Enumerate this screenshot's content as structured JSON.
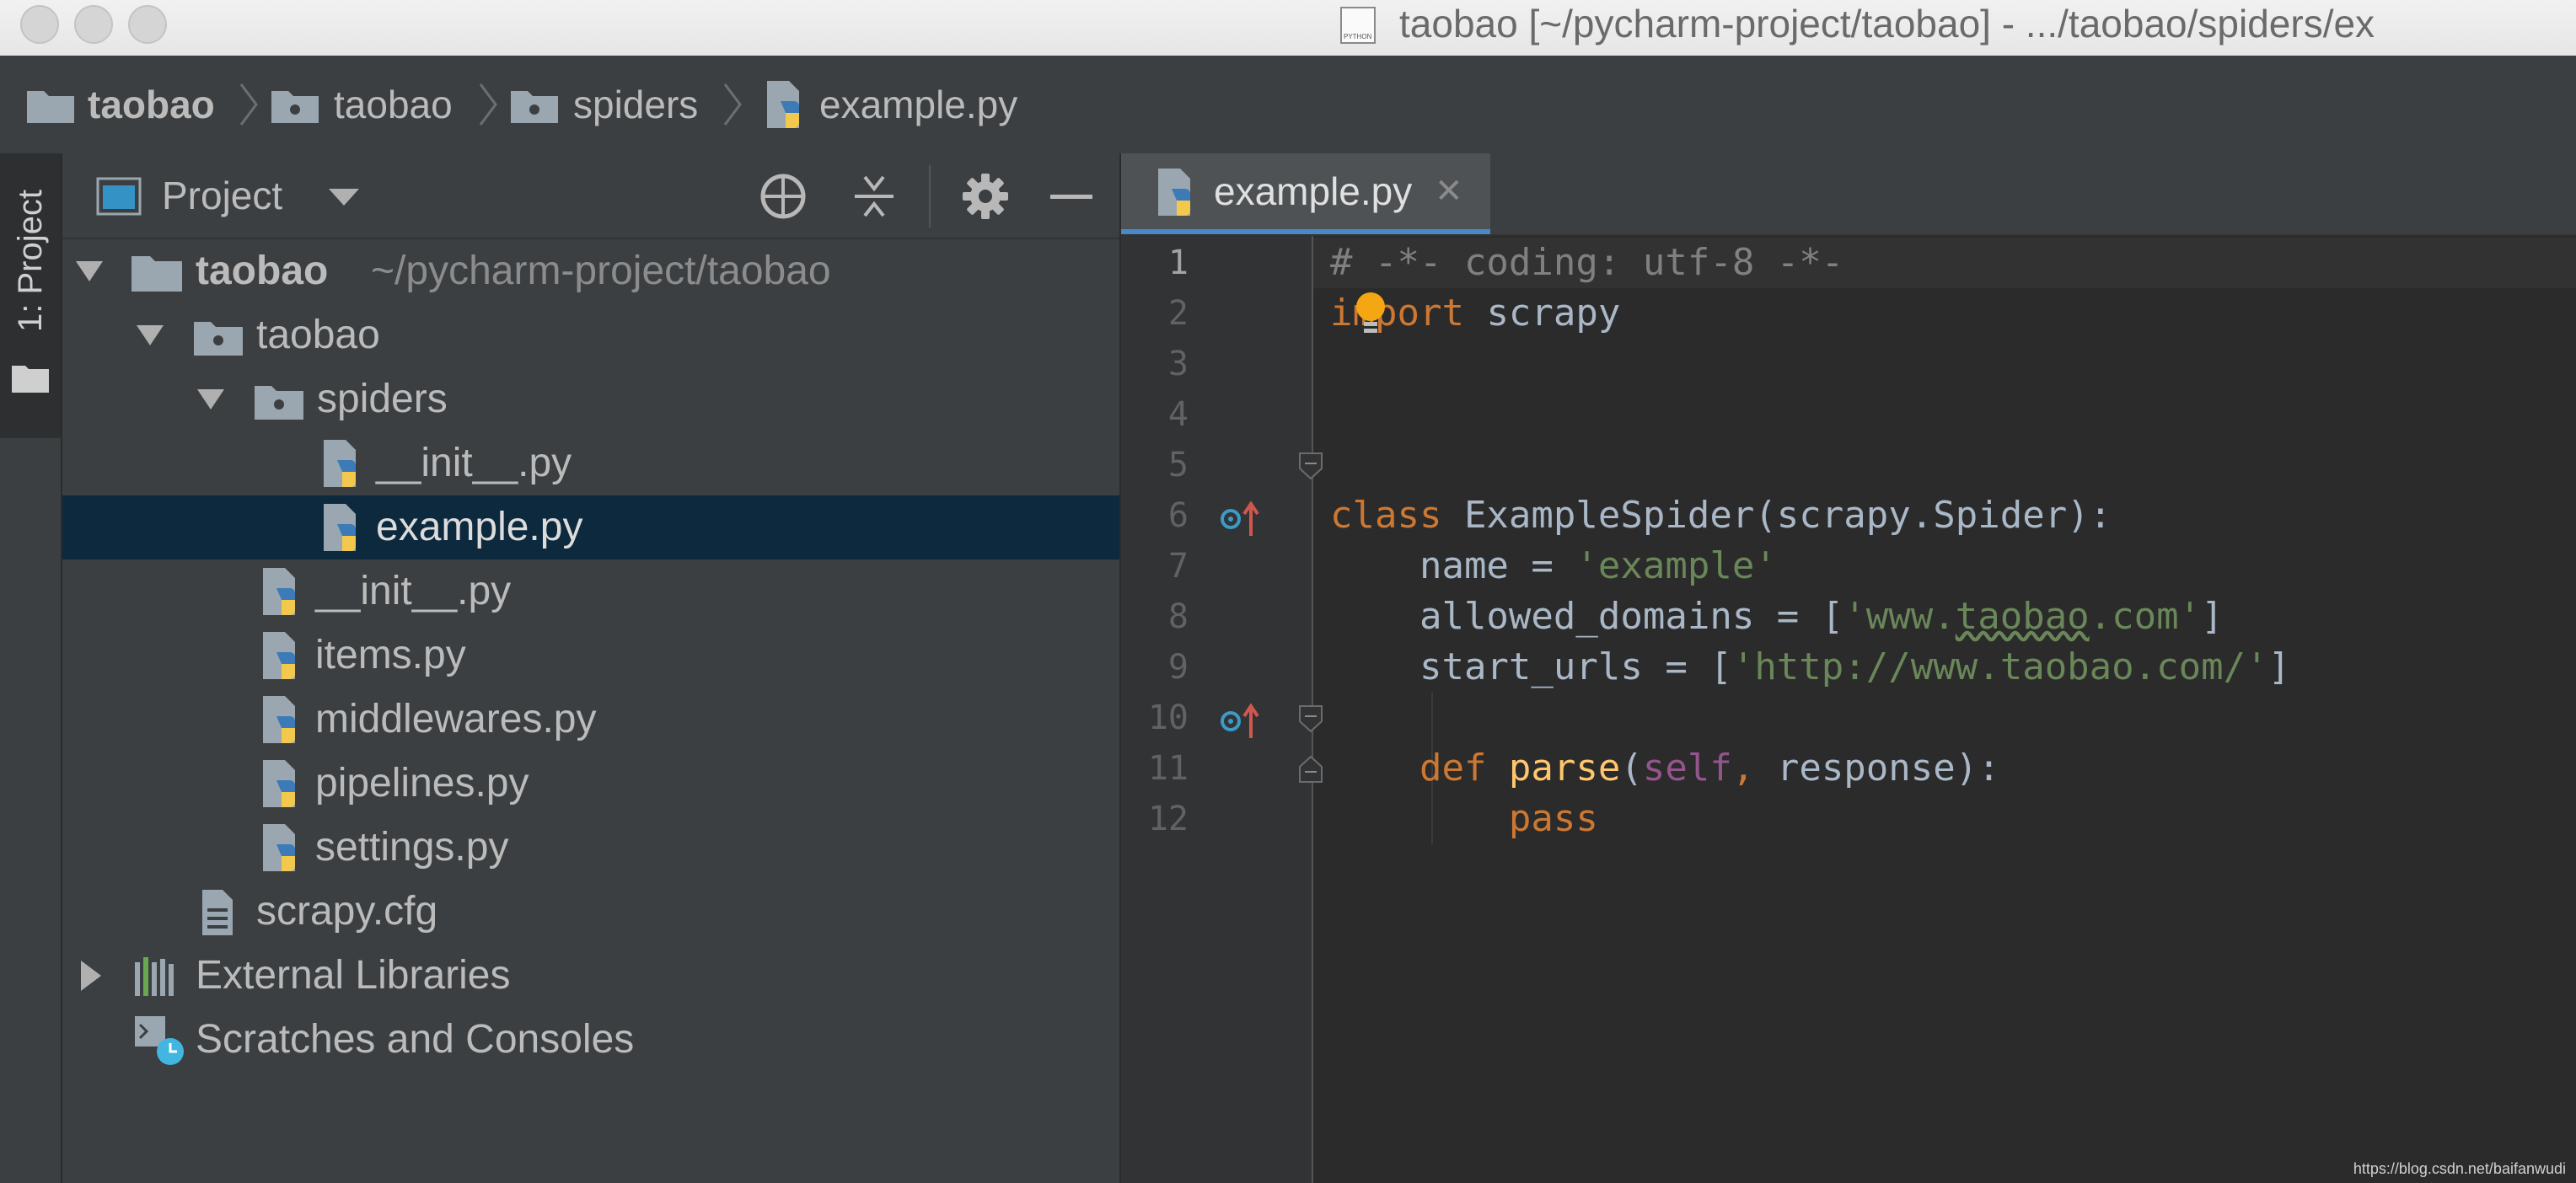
{
  "window": {
    "title": "taobao [~/pycharm-project/taobao] - .../taobao/spiders/ex",
    "file_icon_caption": "PYTHON"
  },
  "breadcrumbs": [
    {
      "label": "taobao"
    },
    {
      "label": "taobao"
    },
    {
      "label": "spiders"
    },
    {
      "label": "example.py"
    }
  ],
  "toolstrip": {
    "project_tab": "1: Project"
  },
  "project_panel": {
    "title": "Project",
    "tree": [
      {
        "label": "taobao",
        "path": "~/pycharm-project/taobao"
      },
      {
        "label": "taobao"
      },
      {
        "label": "spiders"
      },
      {
        "label": "__init__.py"
      },
      {
        "label": "example.py"
      },
      {
        "label": "__init__.py"
      },
      {
        "label": "items.py"
      },
      {
        "label": "middlewares.py"
      },
      {
        "label": "pipelines.py"
      },
      {
        "label": "settings.py"
      },
      {
        "label": "scrapy.cfg"
      },
      {
        "label": "External Libraries"
      },
      {
        "label": "Scratches and Consoles"
      }
    ]
  },
  "editor": {
    "tab": {
      "label": "example.py",
      "close": "✕"
    },
    "line_numbers": [
      "1",
      "2",
      "3",
      "4",
      "5",
      "6",
      "7",
      "8",
      "9",
      "10",
      "11",
      "12"
    ],
    "code": {
      "l1": "# -*- coding: utf-8 -*-",
      "l2_kw": "import",
      "l2_rest": " scrapy",
      "l5_kw": "class",
      "l5_rest": " ExampleSpider(scrapy.Spider):",
      "l6_a": "    name = ",
      "l6_s": "'example'",
      "l7_a": "    allowed_domains = [",
      "l7_s1": "'www.",
      "l7_s2": "taobao",
      "l7_s3": ".com'",
      "l7_b": "]",
      "l8_a": "    start_urls = [",
      "l8_s": "'http://www.taobao.com/'",
      "l8_b": "]",
      "l10_kw": "    def ",
      "l10_fn": "parse",
      "l10_p": "(",
      "l10_self": "self",
      "l10_kw2": ",",
      "l10_rest": " response):",
      "l11_kw": "        pass"
    }
  },
  "watermark": "https://blog.csdn.net/baifanwudi",
  "colors": {
    "background": "#2b2b2b",
    "panel": "#3c3f41",
    "selection": "#0d293e",
    "keyword": "#cc7832",
    "string": "#6a8759",
    "self": "#94558d",
    "function": "#ffc66d",
    "comment": "#808080",
    "accent": "#4a88c7"
  }
}
